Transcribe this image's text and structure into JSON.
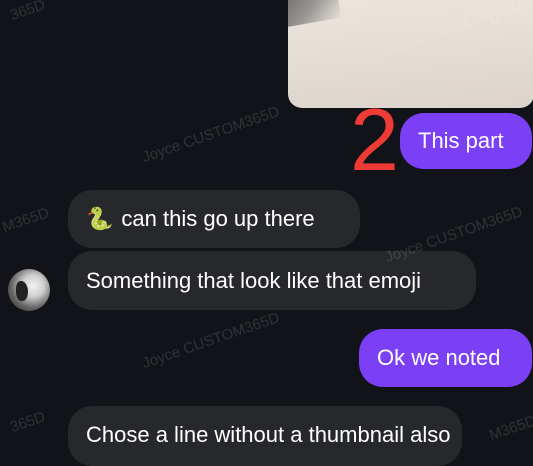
{
  "watermarks": [
    "Joyce CUSTOM365D",
    "Joyce CUSTOM365D",
    "Joyce CUSTOM365D",
    "Joyce CUSTOM365D",
    "365D",
    "M365D",
    "M365D",
    "365D",
    "M365D"
  ],
  "annotation_number": "2",
  "messages": {
    "m1_text": "This part",
    "m2_emoji": "🐍",
    "m2_text": "can this go up there",
    "m3_text": "Something that look like that emoji",
    "m4_text": "Ok we noted",
    "m5_text": "Chose a line without a thumbnail also"
  },
  "colors": {
    "background": "#111318",
    "outgoing_bubble": "#7b3ff5",
    "incoming_bubble": "#26282c",
    "annotation": "#ee3b35"
  }
}
